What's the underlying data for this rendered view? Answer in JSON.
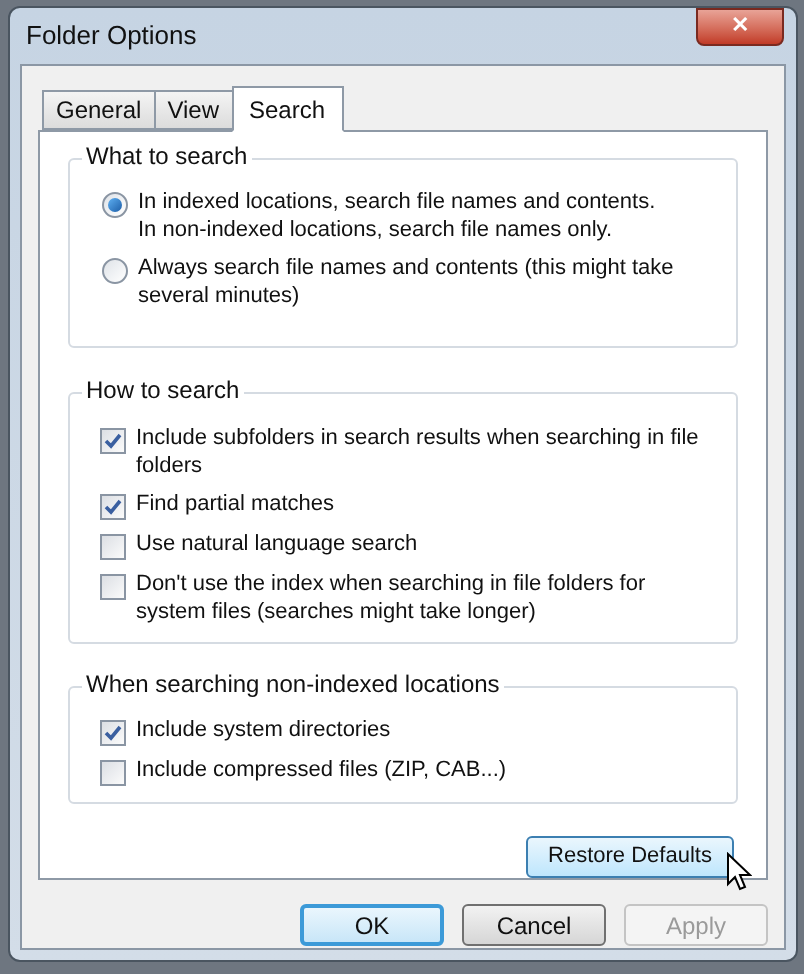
{
  "window": {
    "title": "Folder Options",
    "close_label": "✕"
  },
  "tabs": [
    {
      "label": "General",
      "selected": false
    },
    {
      "label": "View",
      "selected": false
    },
    {
      "label": "Search",
      "selected": true
    }
  ],
  "groups": [
    {
      "title": "What to search",
      "items": [
        {
          "kind": "radio",
          "label": "In indexed locations, search file names and contents.\nIn non-indexed locations, search file names only.",
          "selected": true
        },
        {
          "kind": "radio",
          "label": "Always search file names and contents (this might take several minutes)",
          "selected": false
        }
      ]
    },
    {
      "title": "How to search",
      "items": [
        {
          "kind": "checkbox",
          "label": "Include subfolders in search results when searching in file folders",
          "checked": true
        },
        {
          "kind": "checkbox",
          "label": "Find partial matches",
          "checked": true
        },
        {
          "kind": "checkbox",
          "label": "Use natural language search",
          "checked": false
        },
        {
          "kind": "checkbox",
          "label": "Don't use the index when searching in file folders for system files (searches might take longer)",
          "checked": false
        }
      ]
    },
    {
      "title": "When searching non-indexed locations",
      "items": [
        {
          "kind": "checkbox",
          "label": "Include system directories",
          "checked": true
        },
        {
          "kind": "checkbox",
          "label": "Include compressed files (ZIP, CAB...)",
          "checked": false
        }
      ]
    }
  ],
  "restore_button": {
    "label": "Restore Defaults",
    "hovered": true
  },
  "buttons": [
    {
      "label": "OK",
      "default": true,
      "disabled": false
    },
    {
      "label": "Cancel",
      "default": false,
      "disabled": false
    },
    {
      "label": "Apply",
      "default": false,
      "disabled": true
    }
  ]
}
